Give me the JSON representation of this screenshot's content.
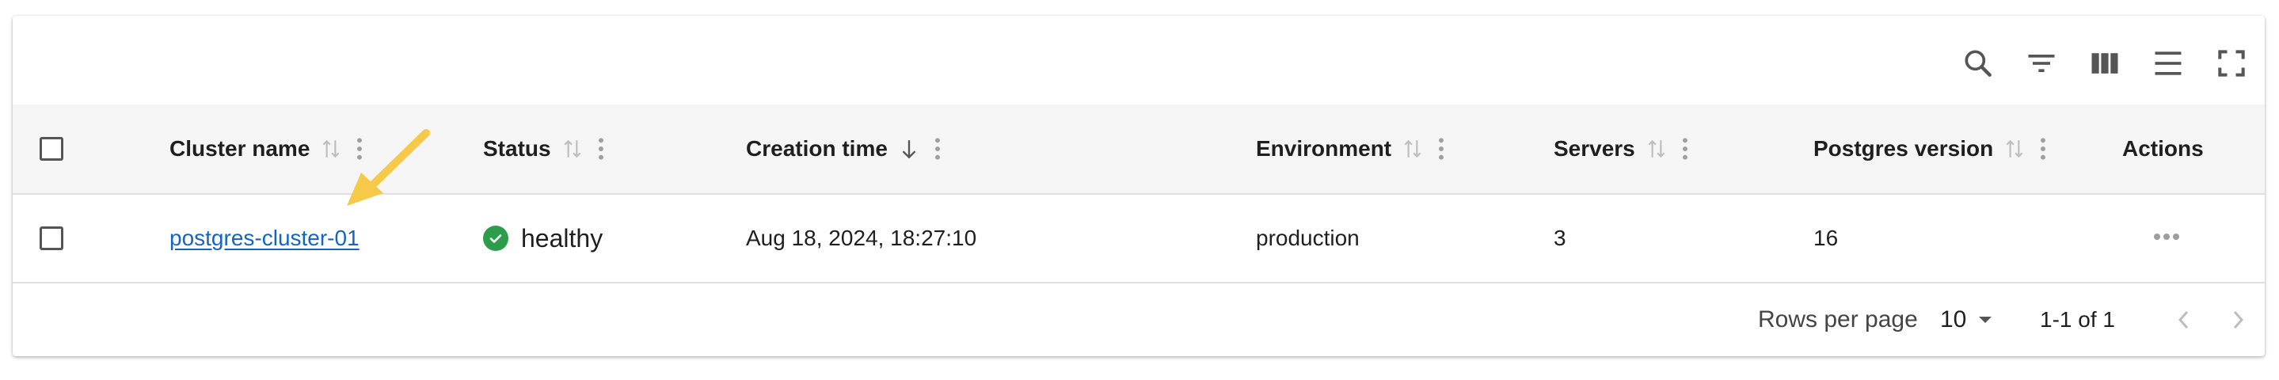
{
  "toolbar": {
    "icons": [
      "search-icon",
      "filter-icon",
      "columns-icon",
      "density-icon",
      "fullscreen-icon"
    ]
  },
  "table": {
    "columns": [
      {
        "label": "Cluster name",
        "sort": "none"
      },
      {
        "label": "Status",
        "sort": "none"
      },
      {
        "label": "Creation time",
        "sort": "desc"
      },
      {
        "label": "Environment",
        "sort": "none"
      },
      {
        "label": "Servers",
        "sort": "none"
      },
      {
        "label": "Postgres version",
        "sort": "none"
      },
      {
        "label": "Actions"
      }
    ],
    "rows": [
      {
        "cluster_name": "postgres-cluster-01",
        "status": "healthy",
        "creation_time": "Aug 18, 2024, 18:27:10",
        "environment": "production",
        "servers": "3",
        "postgres_version": "16",
        "actions": "•••"
      }
    ]
  },
  "pagination": {
    "rows_per_page_label": "Rows per page",
    "rows_per_page_value": "10",
    "range": "1-1 of 1"
  },
  "colors": {
    "link": "#1565c0",
    "status_healthy": "#2e9d4b",
    "annotation_arrow": "#f7c948",
    "header_bg": "#f5f5f5"
  }
}
